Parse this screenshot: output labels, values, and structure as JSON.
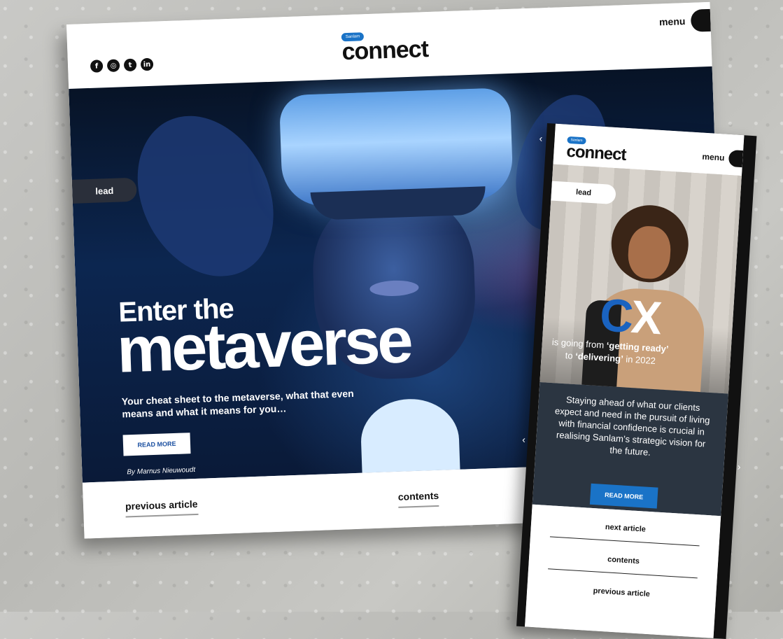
{
  "desktop": {
    "brand": {
      "badge": "Sanlam",
      "name": "connect"
    },
    "menu_label": "menu",
    "social_icons": [
      "facebook-icon",
      "instagram-icon",
      "twitter-icon",
      "linkedin-icon"
    ],
    "social_glyphs": [
      "f",
      "◎",
      "t",
      "in"
    ],
    "lead_label": "lead",
    "hero": {
      "kicker": "Enter the",
      "headline": "metaverse",
      "summary": "Your cheat sheet to the metaverse, what that even means and what it means for you…",
      "read_more": "READ MORE",
      "byline": "By Marnus Nieuwoudt"
    },
    "footer": {
      "previous": "previous article",
      "contents": "contents"
    }
  },
  "mobile": {
    "back_glyph": "‹",
    "brand": {
      "badge": "Sanlam",
      "name": "connect"
    },
    "menu_label": "menu",
    "lead_label": "lead",
    "hero": {
      "cx_c": "C",
      "cx_x": "X",
      "line1_pre": "is going from ",
      "line1_bold": "‘getting ready’",
      "line2_pre": "to ",
      "line2_bold": "‘delivering’",
      "line2_post": " in 2022"
    },
    "body_text": "Staying ahead of what our clients expect and need in the pursuit of living with financial confidence is crucial in realising Sanlam’s strategic vision for the future.",
    "read_more": "READ MORE",
    "prev_arrow": "‹",
    "next_arrow": "›",
    "nav": {
      "next": "next article",
      "contents": "contents",
      "previous": "previous article"
    }
  }
}
